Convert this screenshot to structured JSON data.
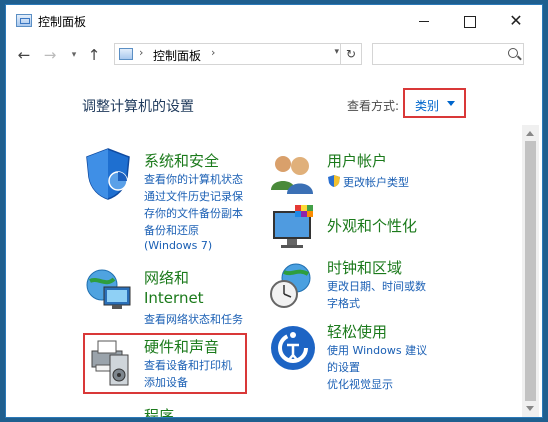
{
  "window": {
    "title": "控制面板"
  },
  "nav": {
    "back": "←",
    "forward": "→",
    "dropdown": "▾",
    "up": "↑",
    "refresh": "↻"
  },
  "address": {
    "sep1": "›",
    "crumb": "控制面板",
    "sep2": "›",
    "dropdown": "▾"
  },
  "search": {
    "placeholder": ""
  },
  "main": {
    "heading": "调整计算机的设置",
    "view_by_label": "查看方式:",
    "view_by_value": "类别"
  },
  "categories": {
    "system": {
      "title": "系统和安全",
      "links": [
        "查看你的计算机状态",
        "通过文件历史记录保",
        "存你的文件备份副本",
        "备份和还原",
        "(Windows 7)"
      ]
    },
    "network": {
      "title_line1": "网络和",
      "title_line2": "Internet",
      "links": [
        "查看网络状态和任务"
      ]
    },
    "hardware": {
      "title": "硬件和声音",
      "links": [
        "查看设备和打印机",
        "添加设备"
      ]
    },
    "programs": {
      "title": "程序"
    },
    "user": {
      "title": "用户帐户",
      "links": [
        "更改帐户类型"
      ]
    },
    "appearance": {
      "title": "外观和个性化"
    },
    "clock": {
      "title": "时钟和区域",
      "links": [
        "更改日期、时间或数",
        "字格式"
      ]
    },
    "ease": {
      "title": "轻松使用",
      "links": [
        "使用 Windows 建议",
        "的设置",
        "优化视觉显示"
      ]
    }
  },
  "colors": {
    "highlight": "#d93838",
    "title_green": "#1b7a1b",
    "link_blue": "#1a5fb4"
  }
}
